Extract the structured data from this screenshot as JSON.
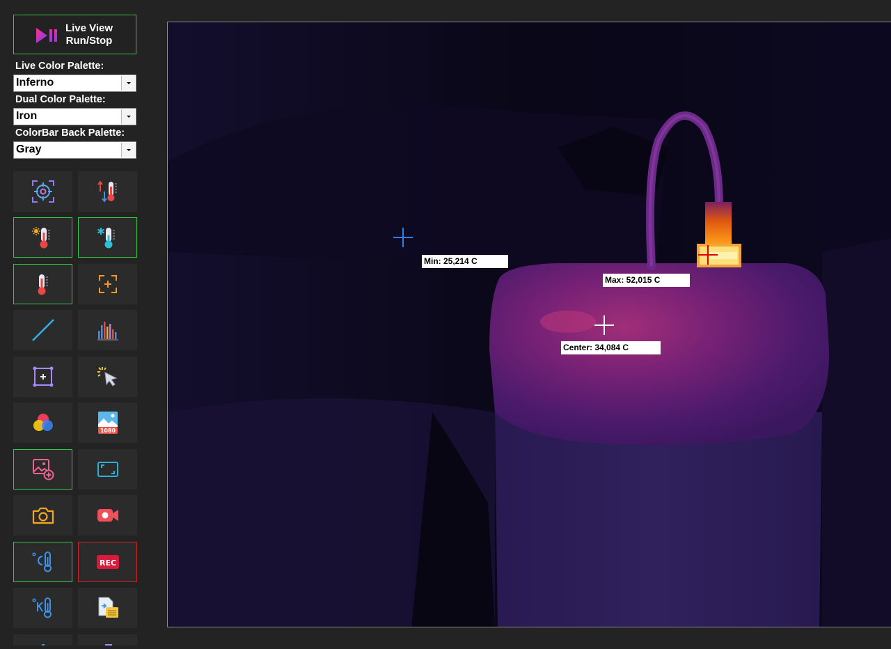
{
  "sidebar": {
    "run_button": {
      "line1": "Live View",
      "line2": "Run/Stop"
    },
    "palettes": [
      {
        "label": "Live Color Palette:",
        "value": "Inferno"
      },
      {
        "label": "Dual Color Palette:",
        "value": "Iron"
      },
      {
        "label": "ColorBar Back Palette:",
        "value": "Gray"
      }
    ],
    "tools": [
      {
        "icon": "target-crosshair-icon",
        "active": false
      },
      {
        "icon": "thermometer-swap-icon",
        "active": false
      },
      {
        "icon": "thermometer-hot-icon",
        "active": true
      },
      {
        "icon": "thermometer-cold-icon",
        "active": true
      },
      {
        "icon": "thermometer-icon",
        "active": true
      },
      {
        "icon": "focus-plus-icon",
        "active": false
      },
      {
        "icon": "line-measure-icon",
        "active": false
      },
      {
        "icon": "histogram-icon",
        "active": false
      },
      {
        "icon": "area-select-icon",
        "active": false
      },
      {
        "icon": "cursor-click-icon",
        "active": false
      },
      {
        "icon": "color-circles-icon",
        "active": false
      },
      {
        "icon": "image-1080-icon",
        "active": false,
        "badge": "1080"
      },
      {
        "icon": "add-image-icon",
        "active": true
      },
      {
        "icon": "aspect-frame-icon",
        "active": false
      },
      {
        "icon": "camera-icon",
        "active": false
      },
      {
        "icon": "video-record-icon",
        "active": false
      },
      {
        "icon": "celsius-thermometer-icon",
        "active": true
      },
      {
        "icon": "rec-icon",
        "active": false,
        "badge": "REC"
      },
      {
        "icon": "kelvin-thermometer-icon",
        "active": false
      },
      {
        "icon": "export-data-icon",
        "active": false
      }
    ]
  },
  "viewport": {
    "min_label": "Min: 25,214 C",
    "max_label": "Max: 52,015 C",
    "center_label": "Center: 34,084 C"
  },
  "colors": {
    "accent_green": "#2ecc40",
    "rec_red": "#d42020",
    "min_marker": "#2f7fe6",
    "max_marker": "#e00000",
    "center_marker": "#ffffff"
  }
}
